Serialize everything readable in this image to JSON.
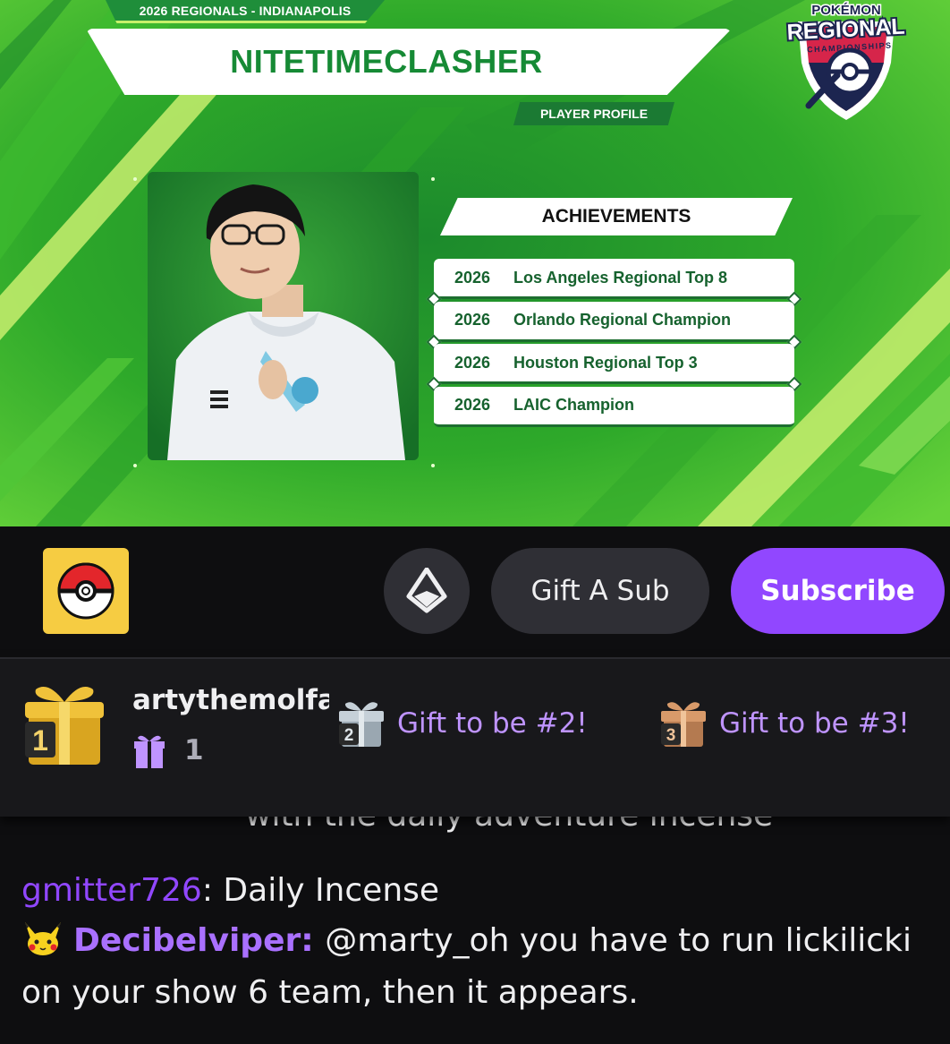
{
  "stream": {
    "event_tag": "2026 REGIONALS - INDIANAPOLIS",
    "player_name": "NITETIMECLASHER",
    "profile_tag": "PLAYER PROFILE",
    "logo": {
      "top_text": "POKÉMON",
      "main_text": "REGIONAL",
      "sub_text": "CHAMPIONSHIPS"
    },
    "achievements_header": "ACHIEVEMENTS",
    "achievements": [
      {
        "year": "2026",
        "title": "Los Angeles Regional Top 8"
      },
      {
        "year": "2026",
        "title": "Orlando Regional Champion"
      },
      {
        "year": "2026",
        "title": "Houston Regional Top 3"
      },
      {
        "year": "2026",
        "title": "LAIC Champion"
      }
    ]
  },
  "channel_bar": {
    "avatar_icon": "pokeball-icon",
    "bits_icon": "bits-icon",
    "gift_label": "Gift A Sub",
    "subscribe_label": "Subscribe",
    "colors": {
      "subscribe": "#9147ff",
      "button": "#2f2f35"
    }
  },
  "gift_leaderboard": {
    "first": {
      "rank": "1",
      "username": "artythemolfa",
      "count": "1"
    },
    "second": {
      "rank": "2",
      "label": "Gift to be #2!"
    },
    "third": {
      "rank": "3",
      "label": "Gift to be #3!"
    }
  },
  "chat": {
    "partial_line": "with the daily adventure incense",
    "messages": [
      {
        "user": "gmitter726",
        "user_color": "#9147ff",
        "text": "Daily Incense"
      },
      {
        "user": "Decibelviper",
        "user_color": "#a970ff",
        "badge": "pikachu-badge-icon",
        "text": "@marty_oh you have to run lickilicki on your show 6 team, then it appears."
      }
    ]
  }
}
